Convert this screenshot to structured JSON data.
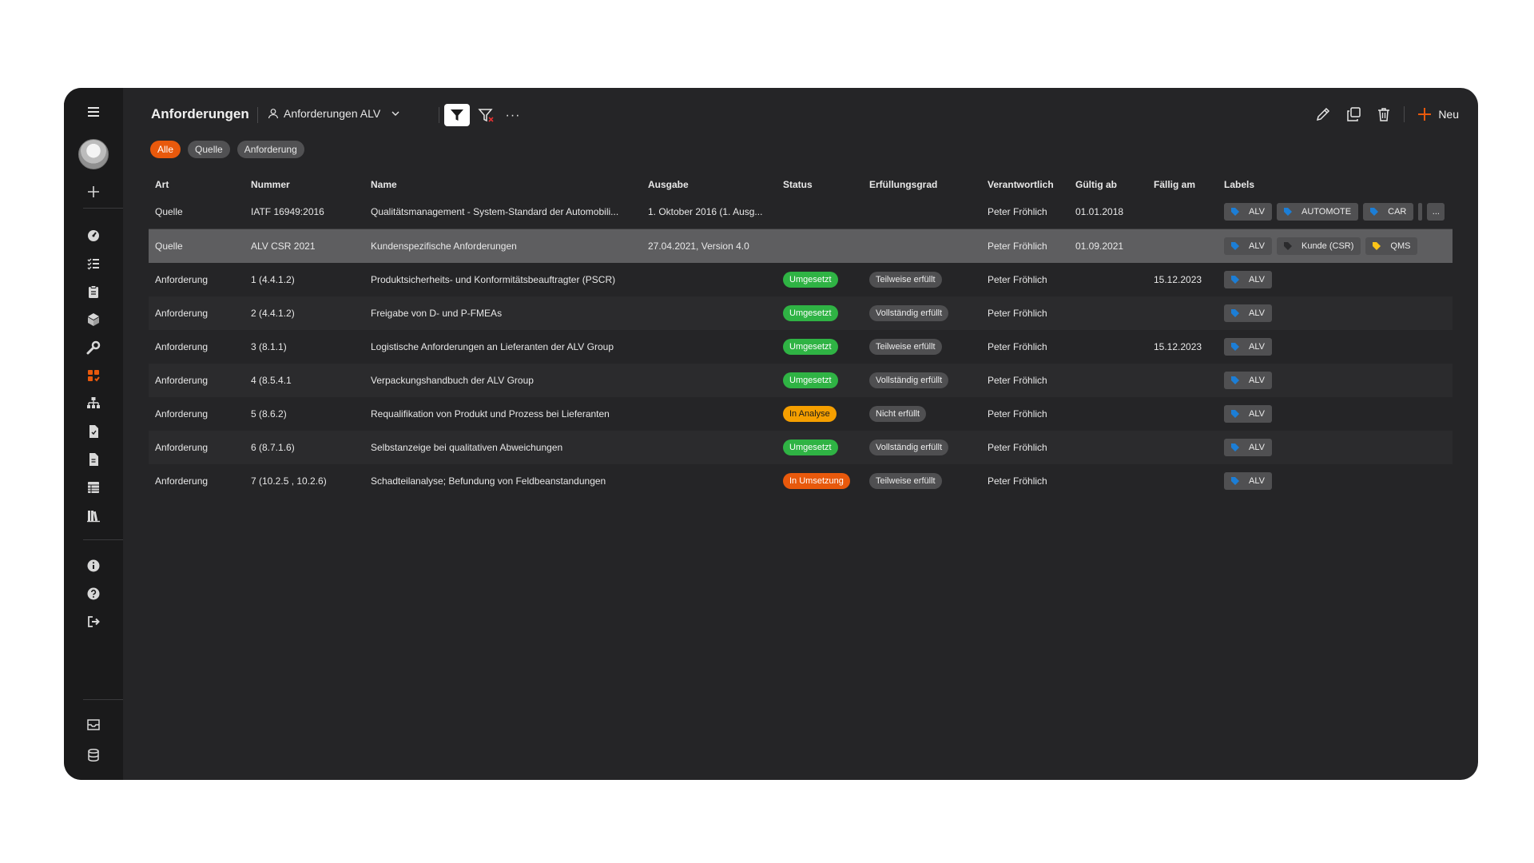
{
  "page": {
    "title": "Anforderungen",
    "view_name": "Anforderungen ALV",
    "more_label": "···",
    "new_label": "Neu"
  },
  "chips": [
    {
      "label": "Alle",
      "active": true
    },
    {
      "label": "Quelle",
      "active": false
    },
    {
      "label": "Anforderung",
      "active": false
    }
  ],
  "columns": {
    "art": "Art",
    "nummer": "Nummer",
    "name": "Name",
    "ausgabe": "Ausgabe",
    "status": "Status",
    "erfuellungsgrad": "Erfüllungsgrad",
    "verantwortlich": "Verantwortlich",
    "gueltig_ab": "Gültig ab",
    "faellig_am": "Fällig am",
    "labels": "Labels"
  },
  "rows": [
    {
      "art": "Quelle",
      "nummer": "IATF 16949:2016",
      "name": "Qualitätsmanagement - System-Standard der Automobili...",
      "ausgabe": "1. Oktober 2016 (1. Ausg...",
      "status": "",
      "erfuellungsgrad": "",
      "verantwortlich": "Peter Fröhlich",
      "gueltig_ab": "01.01.2018",
      "faellig_am": "",
      "labels": [
        {
          "text": "ALV",
          "color": "#1c7ed6"
        },
        {
          "text": "AUTOMOTE",
          "color": "#1c7ed6"
        },
        {
          "text": "CAR",
          "color": "#1c7ed6"
        }
      ],
      "more_label": "...",
      "stub": true
    },
    {
      "art": "Quelle",
      "nummer": "ALV CSR 2021",
      "name": "Kundenspezifische Anforderungen",
      "ausgabe": "27.04.2021, Version 4.0",
      "status": "",
      "erfuellungsgrad": "",
      "verantwortlich": "Peter Fröhlich",
      "gueltig_ab": "01.09.2021",
      "faellig_am": "",
      "labels": [
        {
          "text": "ALV",
          "color": "#1c7ed6"
        },
        {
          "text": "Kunde (CSR)",
          "color": "#2b2b2d"
        },
        {
          "text": "QMS",
          "color": "#fcc419"
        }
      ],
      "selected": true
    },
    {
      "art": "Anforderung",
      "nummer": "1 (4.4.1.2)",
      "name": "Produktsicherheits- und Konformitätsbeauftragter (PSCR)",
      "ausgabe": "",
      "status": "Umgesetzt",
      "status_color": "green",
      "erfuellungsgrad": "Teilweise erfüllt",
      "verantwortlich": "Peter Fröhlich",
      "gueltig_ab": "",
      "faellig_am": "15.12.2023",
      "labels": [
        {
          "text": "ALV",
          "color": "#1c7ed6"
        }
      ]
    },
    {
      "art": "Anforderung",
      "nummer": "2 (4.4.1.2)",
      "name": "Freigabe von D- und P-FMEAs",
      "ausgabe": "",
      "status": "Umgesetzt",
      "status_color": "green",
      "erfuellungsgrad": "Vollständig erfüllt",
      "verantwortlich": "Peter Fröhlich",
      "gueltig_ab": "",
      "faellig_am": "",
      "labels": [
        {
          "text": "ALV",
          "color": "#1c7ed6"
        }
      ]
    },
    {
      "art": "Anforderung",
      "nummer": "3 (8.1.1)",
      "name": "Logistische Anforderungen an Lieferanten der ALV Group",
      "ausgabe": "",
      "status": "Umgesetzt",
      "status_color": "green",
      "erfuellungsgrad": "Teilweise erfüllt",
      "verantwortlich": "Peter Fröhlich",
      "gueltig_ab": "",
      "faellig_am": "15.12.2023",
      "labels": [
        {
          "text": "ALV",
          "color": "#1c7ed6"
        }
      ]
    },
    {
      "art": "Anforderung",
      "nummer": "4 (8.5.4.1",
      "name": "Verpackungshandbuch der ALV Group",
      "ausgabe": "",
      "status": "Umgesetzt",
      "status_color": "green",
      "erfuellungsgrad": "Vollständig erfüllt",
      "verantwortlich": "Peter Fröhlich",
      "gueltig_ab": "",
      "faellig_am": "",
      "labels": [
        {
          "text": "ALV",
          "color": "#1c7ed6"
        }
      ]
    },
    {
      "art": "Anforderung",
      "nummer": "5 (8.6.2)",
      "name": "Requalifikation von Produkt und Prozess bei Lieferanten",
      "ausgabe": "",
      "status": "In Analyse",
      "status_color": "yellow",
      "erfuellungsgrad": "Nicht erfüllt",
      "verantwortlich": "Peter Fröhlich",
      "gueltig_ab": "",
      "faellig_am": "",
      "labels": [
        {
          "text": "ALV",
          "color": "#1c7ed6"
        }
      ]
    },
    {
      "art": "Anforderung",
      "nummer": "6 (8.7.1.6)",
      "name": "Selbstanzeige bei qualitativen Abweichungen",
      "ausgabe": "",
      "status": "Umgesetzt",
      "status_color": "green",
      "erfuellungsgrad": "Vollständig erfüllt",
      "verantwortlich": "Peter Fröhlich",
      "gueltig_ab": "",
      "faellig_am": "",
      "labels": [
        {
          "text": "ALV",
          "color": "#1c7ed6"
        }
      ]
    },
    {
      "art": "Anforderung",
      "nummer": "7 (10.2.5 , 10.2.6)",
      "name": "Schadteilanalyse; Befundung von Feldbeanstandungen",
      "ausgabe": "",
      "status": "In Umsetzung",
      "status_color": "orange",
      "erfuellungsgrad": "Teilweise erfüllt",
      "verantwortlich": "Peter Fröhlich",
      "gueltig_ab": "",
      "faellig_am": "",
      "labels": [
        {
          "text": "ALV",
          "color": "#1c7ed6"
        }
      ]
    }
  ],
  "sidebar": {
    "icons": [
      "menu-icon",
      "avatar",
      "add-icon",
      "dashboard-icon",
      "list-check-icon",
      "clipboard-icon",
      "boxes-icon",
      "wrench-icon",
      "requirements-icon",
      "org-chart-icon",
      "document-icon",
      "document-text-icon",
      "table-icon",
      "library-icon",
      "info-icon",
      "help-icon",
      "logout-icon",
      "inbox-icon",
      "database-icon"
    ],
    "active_icon": "requirements-icon",
    "accent_color": "#e8590c"
  }
}
